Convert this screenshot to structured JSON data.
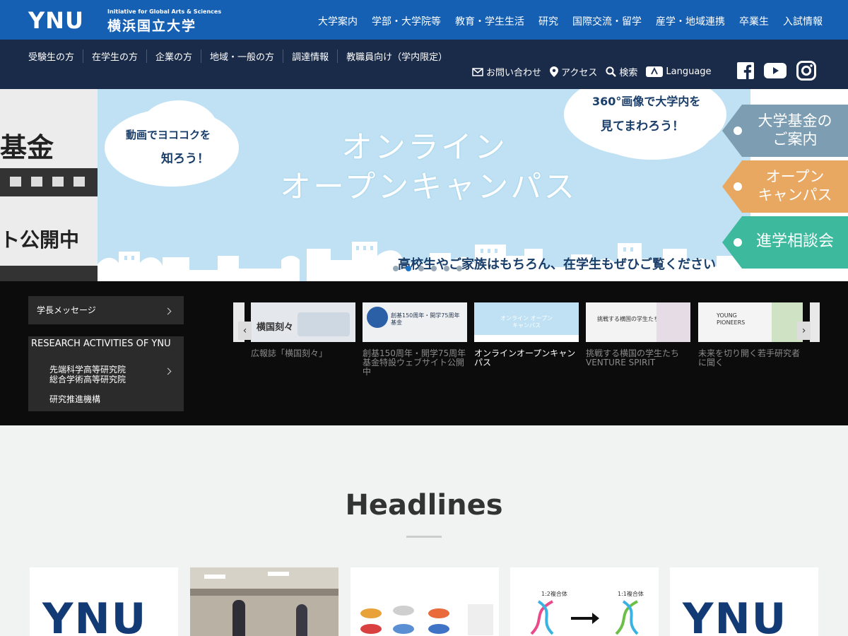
{
  "header": {
    "logo_text": "YNU",
    "logo_subtitle": "Initiative for Global Arts & Sciences",
    "logo_japanese": "横浜国立大学",
    "main_nav": [
      "大学案内",
      "学部・大学院等",
      "教育・学生生活",
      "研究",
      "国際交流・留学",
      "産学・地域連携",
      "卒業生",
      "入試情報"
    ]
  },
  "subheader": {
    "audience_nav": [
      "受験生の方",
      "在学生の方",
      "企業の方",
      "地域・一般の方",
      "調達情報",
      "教職員向け（学内限定）"
    ],
    "utility": {
      "contact": "お問い合わせ",
      "access": "アクセス",
      "search": "検索",
      "language": "Language"
    },
    "social": [
      "facebook-icon",
      "youtube-icon",
      "instagram-icon"
    ]
  },
  "hero": {
    "left_slide_text_1": "基金",
    "left_slide_text_2": "ト公開中",
    "title_line1": "オンライン",
    "title_line2": "オープンキャンパス",
    "bubble_left_1": "動画でヨココクを",
    "bubble_left_2": "知ろう！",
    "bubble_right_1": "360°画像で大学内を",
    "bubble_right_2": "見てまわろう！",
    "caption": "高校生やご家族はもちろん、在学生もぜひご覧ください",
    "side_tags": [
      {
        "line1": "大学基金の",
        "line2": "ご案内",
        "color": "#7c9db2"
      },
      {
        "line1": "オープン",
        "line2": "キャンパス",
        "color": "#e9a862"
      },
      {
        "line1": "進学相談会",
        "line2": "",
        "color": "#3dba9e"
      }
    ],
    "active_dot": 2,
    "dot_count": 6
  },
  "dark_section": {
    "menu_president": "学長メッセージ",
    "menu_research_title": "RESEARCH ACTIVITIES OF YNU",
    "menu_research_item1a": "先端科学高等研究院",
    "menu_research_item1b": "総合学術高等研究院",
    "menu_research_item2": "研究推進機構",
    "carousel_prev": "‹",
    "carousel_next": "›",
    "cards": [
      {
        "caption": "広報誌「横国刻々」",
        "thumb_text": "横国刻々"
      },
      {
        "caption": "創基150周年・開学75周年基金特設ウェブサイト公開中",
        "thumb_text": "創基150周年・開学75周年基金"
      },
      {
        "caption": "オンラインオープンキャンパス",
        "thumb_text": "オンライン オープンキャンパス"
      },
      {
        "caption": "挑戦する横国の学生たち VENTURE SPIRIT",
        "thumb_text": "挑戦する横国の学生たち"
      },
      {
        "caption": "未来を切り開く若手研究者に聞く",
        "thumb_text": "YOUNG PIONEERS"
      }
    ]
  },
  "headlines": {
    "title": "Headlines",
    "news_logo_1": "YNU",
    "news_logo_5": "YNU",
    "news_diagram_label_1": "1:2複合体",
    "news_diagram_label_2": "1:1複合体"
  }
}
